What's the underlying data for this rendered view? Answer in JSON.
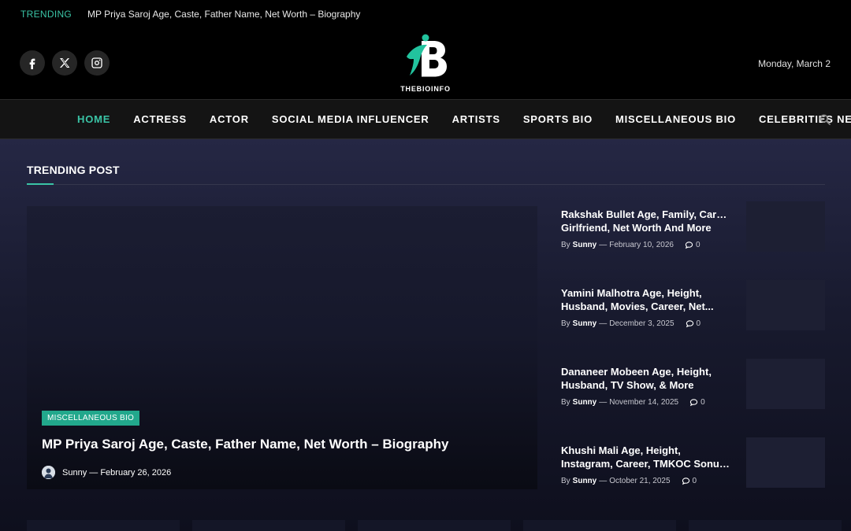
{
  "trending": {
    "label": "TRENDING",
    "title": "MP Priya Saroj Age, Caste, Father Name, Net Worth – Biography"
  },
  "header": {
    "logo_text": "THEBIOINFO",
    "date": "Monday, March 2",
    "social": [
      "facebook-icon",
      "x-icon",
      "instagram-icon"
    ]
  },
  "nav": {
    "items": [
      {
        "label": "HOME",
        "active": true
      },
      {
        "label": "ACTRESS"
      },
      {
        "label": "ACTOR"
      },
      {
        "label": "SOCIAL MEDIA INFLUENCER"
      },
      {
        "label": "ARTISTS"
      },
      {
        "label": "SPORTS BIO"
      },
      {
        "label": "MISCELLANEOUS BIO"
      },
      {
        "label": "CELEBRITIES NEWS"
      }
    ],
    "search_icon": "search-icon"
  },
  "section": {
    "title": "TRENDING POST"
  },
  "featured": {
    "category": "MISCELLANEOUS BIO",
    "title": "MP Priya Saroj Age, Caste, Father Name, Net Worth – Biography",
    "author": "Sunny",
    "date": "February 26, 2026"
  },
  "side_posts": [
    {
      "title_line1": "Rakshak Bullet Age, Family, Career,",
      "title_line2": "Girlfriend, Net Worth And More",
      "by": "By",
      "author": "Sunny",
      "date": "February 10, 2026",
      "comments": "0"
    },
    {
      "title_line1": "Yamini Malhotra Age, Height,",
      "title_line2": "Husband, Movies, Career, Net...",
      "by": "By",
      "author": "Sunny",
      "date": "December 3, 2025",
      "comments": "0"
    },
    {
      "title_line1": "Dananeer Mobeen Age, Height,",
      "title_line2": "Husband, TV Show, & More",
      "by": "By",
      "author": "Sunny",
      "date": "November 14, 2025",
      "comments": "0"
    },
    {
      "title_line1": "Khushi Mali Age, Height,",
      "title_line2": "Instagram, Career, TMKOC Sonu ...",
      "by": "By",
      "author": "Sunny",
      "date": "October 21, 2025",
      "comments": "0"
    }
  ],
  "colors": {
    "accent": "#3ac4a6",
    "category_badge": "#22a88c"
  }
}
